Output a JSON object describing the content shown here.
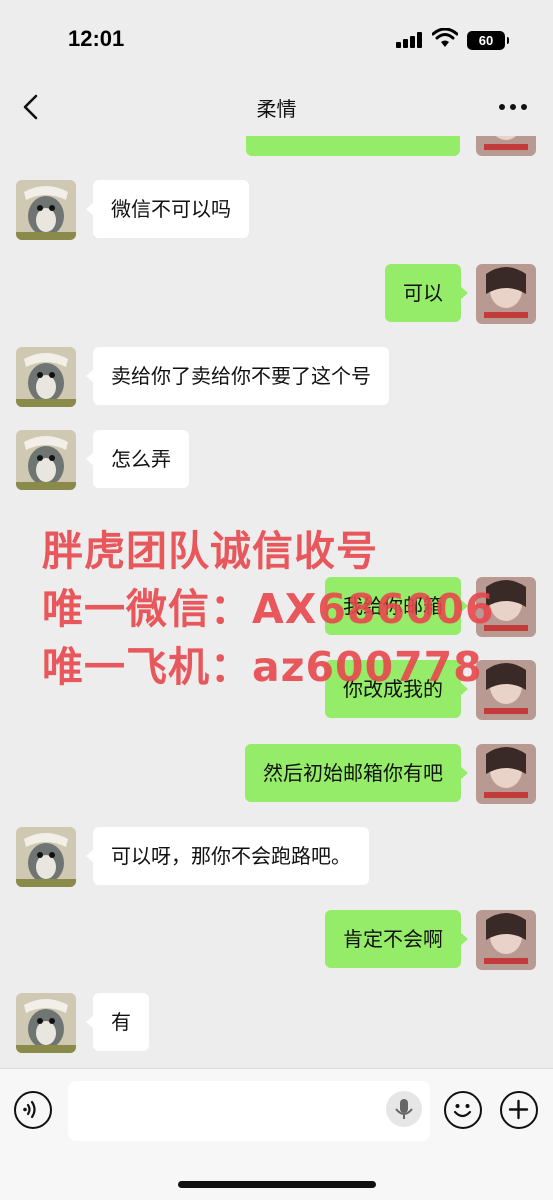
{
  "status_bar": {
    "time": "12:01",
    "battery": "60"
  },
  "nav": {
    "title": "柔情"
  },
  "messages": [
    {
      "side": "in",
      "text": "微信不可以吗"
    },
    {
      "side": "out",
      "text": "可以"
    },
    {
      "side": "in",
      "text": "卖给你了卖给你不要了这个号"
    },
    {
      "side": "in",
      "text": "怎么弄"
    },
    {
      "side": "out",
      "text": "我给你邮箱"
    },
    {
      "side": "out",
      "text": "你改成我的"
    },
    {
      "side": "out",
      "text": "然后初始邮箱你有吧"
    },
    {
      "side": "in",
      "text": "可以呀，那你不会跑路吧。"
    },
    {
      "side": "out",
      "text": "肯定不会啊"
    },
    {
      "side": "in",
      "text": "有"
    }
  ],
  "watermark": {
    "line1": "胖虎团队诚信收号",
    "line2": "唯一微信：AX686006",
    "line3": "唯一飞机：az600778"
  },
  "icons": {
    "back": "chevron-left-icon",
    "more": "more-horizontal-icon",
    "voice": "voice-icon",
    "mic": "mic-icon",
    "emoji": "emoji-icon",
    "plus": "plus-icon"
  },
  "colors": {
    "outgoing_bubble": "#95ec69",
    "incoming_bubble": "#ffffff",
    "watermark": "#e8474c"
  }
}
